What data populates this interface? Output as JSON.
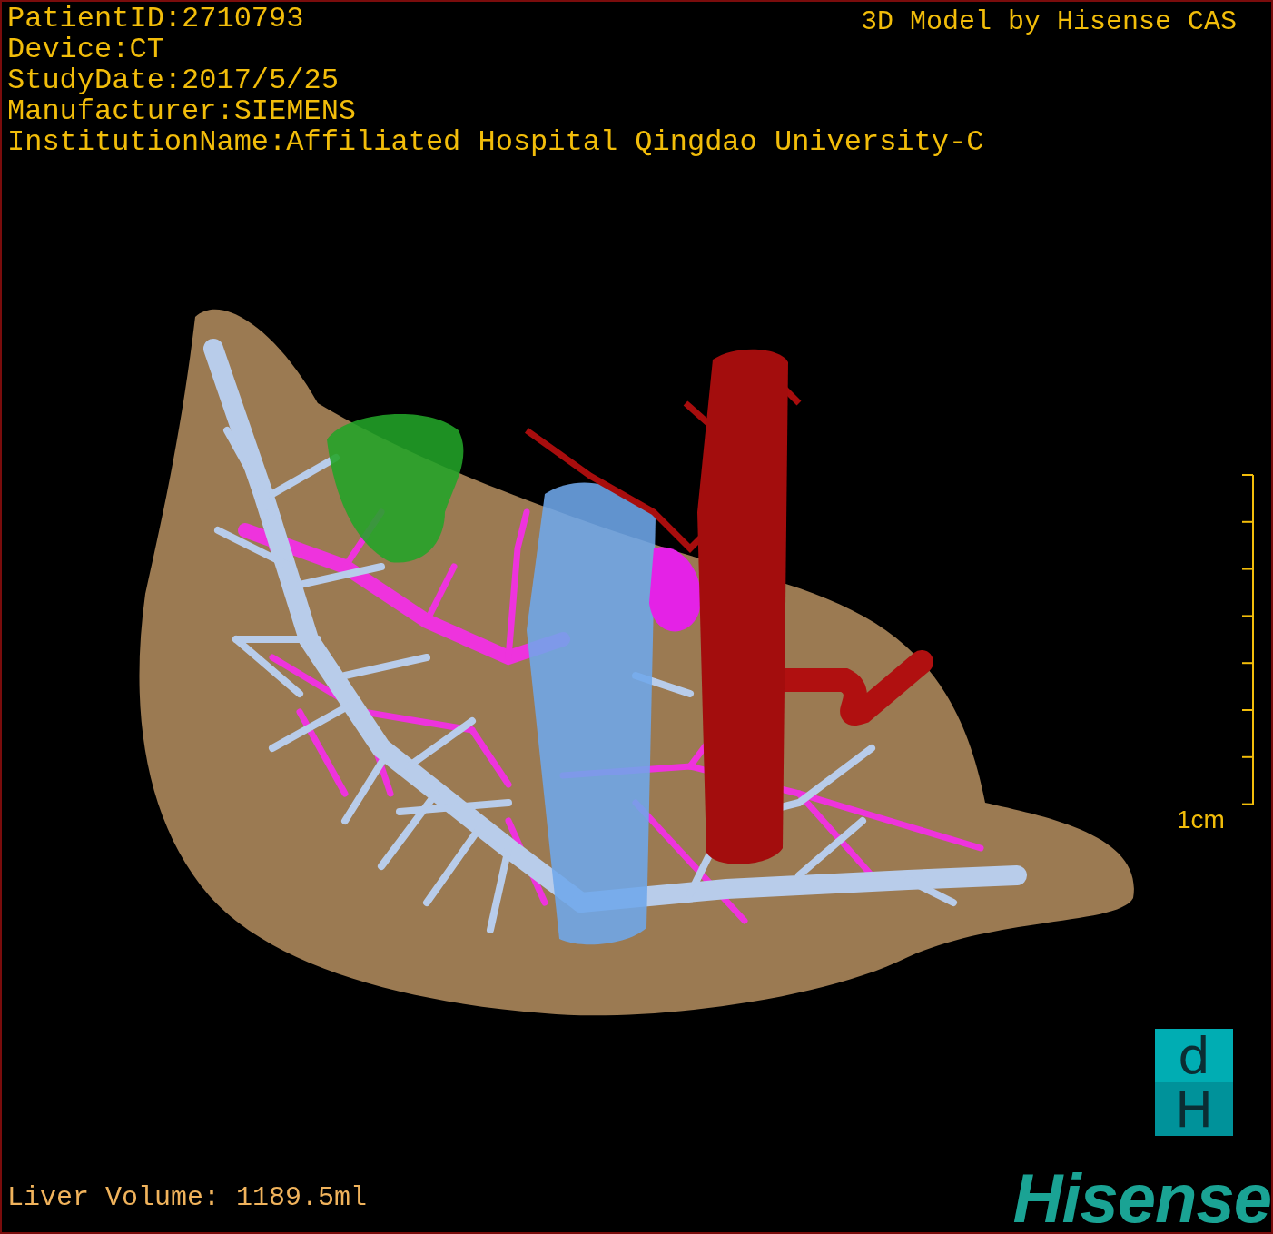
{
  "info": [
    "PatientID:2710793",
    "Device:CT",
    "StudyDate:2017/5/25",
    "Manufacturer:SIEMENS",
    "InstitutionName:Affiliated Hospital Qingdao University-C"
  ],
  "credit": "3D Model by Hisense CAS",
  "scale": {
    "label": "1cm"
  },
  "liver_volume": "Liver Volume: 1189.5ml",
  "logo": {
    "badge_top": "d",
    "badge_bottom": "H",
    "wordmark": "Hisense"
  }
}
